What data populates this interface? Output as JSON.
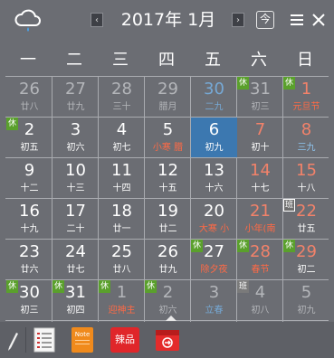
{
  "header": {
    "title": "2017年 1月",
    "prev_label": "‹",
    "next_label": "›",
    "today_label": "今",
    "weather_icon": "cloud-rain-icon",
    "menu_icon": "hamburger-icon",
    "close_icon": "close-icon"
  },
  "weekdays": [
    "一",
    "二",
    "三",
    "四",
    "五",
    "六",
    "日"
  ],
  "tags": {
    "rest": "休",
    "work": "班"
  },
  "days": [
    {
      "d": "26",
      "l": "廿八",
      "tone": "dim"
    },
    {
      "d": "27",
      "l": "廿九",
      "tone": "dim"
    },
    {
      "d": "28",
      "l": "三十",
      "tone": "dim"
    },
    {
      "d": "29",
      "l": "腊月",
      "tone": "dim"
    },
    {
      "d": "30",
      "l": "二九",
      "tone": "bluedim"
    },
    {
      "d": "31",
      "l": "初三",
      "tone": "dim",
      "tag": "rest"
    },
    {
      "d": "1",
      "l": "元旦节",
      "tone": "red",
      "tag": "rest",
      "lunartone": "redlunar"
    },
    {
      "d": "2",
      "l": "初五",
      "tone": "white",
      "tag": "rest"
    },
    {
      "d": "3",
      "l": "初六",
      "tone": "white"
    },
    {
      "d": "4",
      "l": "初七",
      "tone": "white"
    },
    {
      "d": "5",
      "l": "小寒 腊",
      "tone": "white",
      "lunartone": "redlunar"
    },
    {
      "d": "6",
      "l": "初九",
      "tone": "white",
      "today": true
    },
    {
      "d": "7",
      "l": "初十",
      "tone": "red"
    },
    {
      "d": "8",
      "l": "三九",
      "tone": "red",
      "lunartone": "blue"
    },
    {
      "d": "9",
      "l": "十二",
      "tone": "white"
    },
    {
      "d": "10",
      "l": "十三",
      "tone": "white"
    },
    {
      "d": "11",
      "l": "十四",
      "tone": "white"
    },
    {
      "d": "12",
      "l": "十五",
      "tone": "white"
    },
    {
      "d": "13",
      "l": "十六",
      "tone": "white"
    },
    {
      "d": "14",
      "l": "十七",
      "tone": "red"
    },
    {
      "d": "15",
      "l": "十八",
      "tone": "red"
    },
    {
      "d": "16",
      "l": "十九",
      "tone": "white"
    },
    {
      "d": "17",
      "l": "二十",
      "tone": "white"
    },
    {
      "d": "18",
      "l": "廿一",
      "tone": "white"
    },
    {
      "d": "19",
      "l": "廿二",
      "tone": "white"
    },
    {
      "d": "20",
      "l": "大寒 小",
      "tone": "white",
      "lunartone": "redlunar"
    },
    {
      "d": "21",
      "l": "小年(南",
      "tone": "red",
      "lunartone": "redlunar"
    },
    {
      "d": "22",
      "l": "廿五",
      "tone": "red",
      "tag": "work"
    },
    {
      "d": "23",
      "l": "廿六",
      "tone": "white"
    },
    {
      "d": "24",
      "l": "廿七",
      "tone": "white"
    },
    {
      "d": "25",
      "l": "廿八",
      "tone": "white"
    },
    {
      "d": "26",
      "l": "廿九",
      "tone": "white"
    },
    {
      "d": "27",
      "l": "除夕夜",
      "tone": "white",
      "tag": "rest",
      "lunartone": "redlunar"
    },
    {
      "d": "28",
      "l": "春节",
      "tone": "red",
      "tag": "rest",
      "lunartone": "redlunar"
    },
    {
      "d": "29",
      "l": "初二",
      "tone": "red",
      "tag": "rest"
    },
    {
      "d": "30",
      "l": "初三",
      "tone": "white",
      "tag": "rest"
    },
    {
      "d": "31",
      "l": "初四",
      "tone": "white",
      "tag": "rest"
    },
    {
      "d": "1",
      "l": "迎神主",
      "tone": "dim",
      "tag": "rest",
      "lunartone": "redlunar"
    },
    {
      "d": "2",
      "l": "初六",
      "tone": "dim",
      "tag": "rest"
    },
    {
      "d": "3",
      "l": "立春",
      "tone": "dim",
      "lunartone": "bluedim"
    },
    {
      "d": "4",
      "l": "初八",
      "tone": "dim",
      "tag": "work"
    },
    {
      "d": "5",
      "l": "初九",
      "tone": "dim"
    }
  ],
  "toolbar": [
    {
      "name": "pen-tool-button",
      "icon": "pen-icon"
    },
    {
      "name": "list-button",
      "icon": "list-icon"
    },
    {
      "name": "note-button",
      "icon": "note-icon",
      "label": "Note"
    },
    {
      "name": "apps-button",
      "icon": "apps-icon",
      "label": "辣品"
    },
    {
      "name": "inbox-button",
      "icon": "inbox-icon"
    }
  ]
}
